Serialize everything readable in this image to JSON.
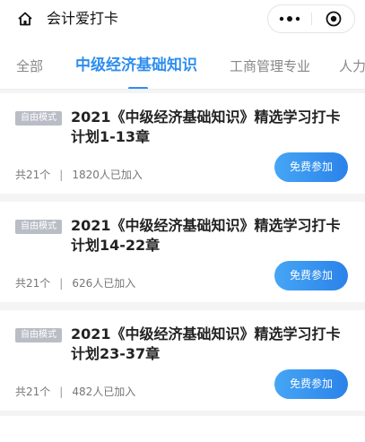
{
  "header": {
    "title": "会计爱打卡",
    "icons": {
      "home": "home-icon",
      "more": "more-dots-icon",
      "close": "capsule-close-icon"
    }
  },
  "tabs": [
    {
      "label": "全部",
      "active": false
    },
    {
      "label": "中级经济基础知识",
      "active": true
    },
    {
      "label": "工商管理专业",
      "active": false
    },
    {
      "label": "人力",
      "active": false
    }
  ],
  "cards": [
    {
      "badge": "自由模式",
      "title": "2021《中级经济基础知识》精选学习打卡计划1-13章",
      "count": "共21个",
      "divider": "|",
      "joined": "1820人已加入",
      "button": "免费参加"
    },
    {
      "badge": "自由模式",
      "title": "2021《中级经济基础知识》精选学习打卡计划14-22章",
      "count": "共21个",
      "divider": "|",
      "joined": "626人已加入",
      "button": "免费参加"
    },
    {
      "badge": "自由模式",
      "title": "2021《中级经济基础知识》精选学习打卡计划23-37章",
      "count": "共21个",
      "divider": "|",
      "joined": "482人已加入",
      "button": "免费参加"
    }
  ],
  "colors": {
    "accent": "#2e8ef0",
    "badge": "#b9bdc6",
    "background": "#f4f4f4"
  }
}
